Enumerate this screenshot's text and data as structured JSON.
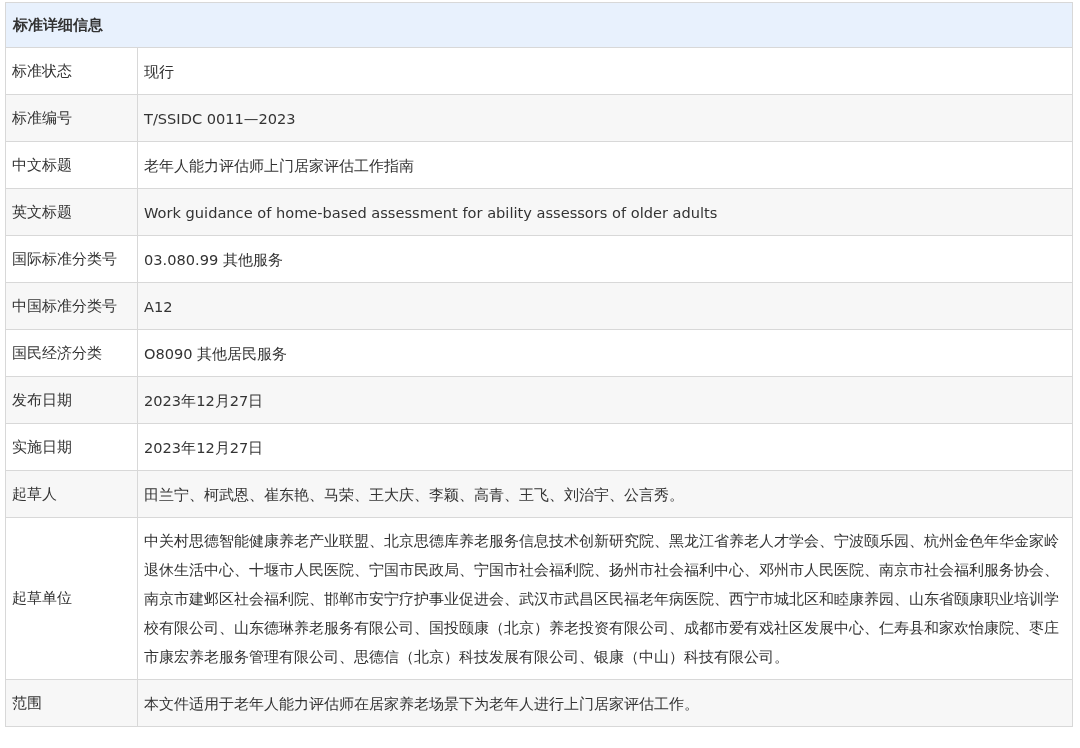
{
  "table": {
    "title": "标准详细信息",
    "rows": [
      {
        "label": "标准状态",
        "value": "现行"
      },
      {
        "label": "标准编号",
        "value": "T/SSIDC 0011—2023"
      },
      {
        "label": "中文标题",
        "value": "老年人能力评估师上门居家评估工作指南"
      },
      {
        "label": "英文标题",
        "value": "Work guidance of home-based assessment for ability assessors of older adults"
      },
      {
        "label": "国际标准分类号",
        "value": "03.080.99 其他服务"
      },
      {
        "label": "中国标准分类号",
        "value": "A12"
      },
      {
        "label": "国民经济分类",
        "value": "O8090 其他居民服务"
      },
      {
        "label": "发布日期",
        "value": "2023年12月27日"
      },
      {
        "label": "实施日期",
        "value": "2023年12月27日"
      },
      {
        "label": "起草人",
        "value": "田兰宁、柯武恩、崔东艳、马荣、王大庆、李颖、高青、王飞、刘治宇、公言秀。"
      },
      {
        "label": "起草单位",
        "value": "中关村思德智能健康养老产业联盟、北京思德库养老服务信息技术创新研究院、黑龙江省养老人才学会、宁波颐乐园、杭州金色年华金家岭退休生活中心、十堰市人民医院、宁国市民政局、宁国市社会福利院、扬州市社会福利中心、邓州市人民医院、南京市社会福利服务协会、南京市建邺区社会福利院、邯郸市安宁疗护事业促进会、武汉市武昌区民福老年病医院、西宁市城北区和睦康养园、山东省颐康职业培训学校有限公司、山东德琳养老服务有限公司、国投颐康（北京）养老投资有限公司、成都市爱有戏社区发展中心、仁寿县和家欢怡康院、枣庄市康宏养老服务管理有限公司、思德信（北京）科技发展有限公司、银康（中山）科技有限公司。"
      },
      {
        "label": "范围",
        "value": "本文件适用于老年人能力评估师在居家养老场景下为老年人进行上门居家评估工作。"
      }
    ]
  }
}
